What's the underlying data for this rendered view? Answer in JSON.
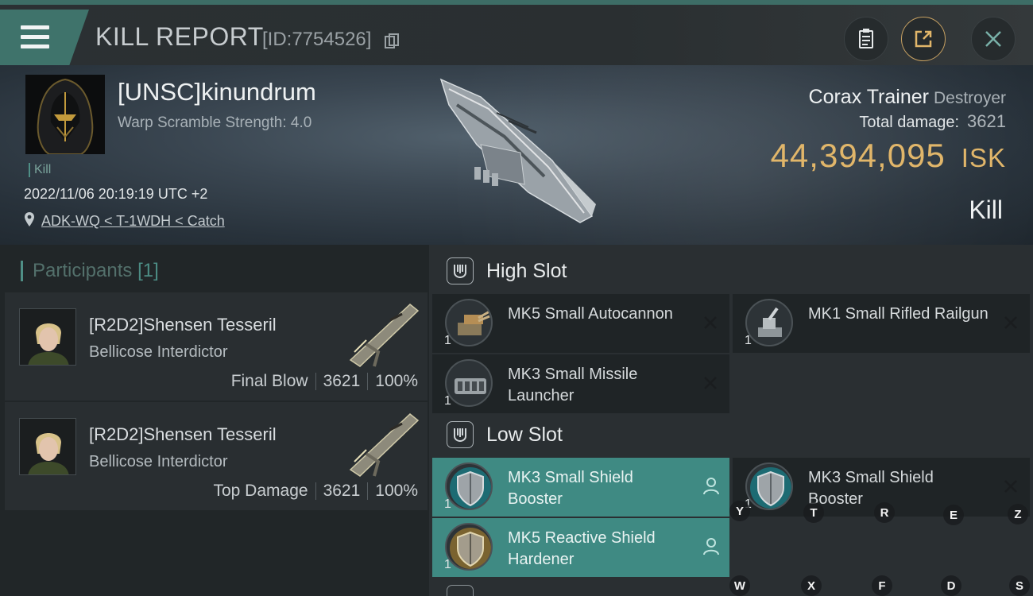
{
  "header": {
    "title": "KILL REPORT",
    "report_id": "[ID:7754526]"
  },
  "victim": {
    "name": "[UNSC]kinundrum",
    "scramble": "Warp Scramble Strength: 4.0",
    "tag": "Kill",
    "datetime": "2022/11/06 20:19:19 UTC +2",
    "location": "ADK-WQ < T-1WDH < Catch"
  },
  "ship": {
    "name": "Corax Trainer",
    "class": "Destroyer",
    "total_damage_label": "Total damage:",
    "total_damage": "3621",
    "isk_value": "44,394,095",
    "isk_unit": "ISK",
    "result": "Kill"
  },
  "participants": {
    "label": "Participants",
    "count": "[1]",
    "rows": [
      {
        "name": "[R2D2]Shensen Tesseril",
        "ship": "Bellicose Interdictor",
        "role": "Final Blow",
        "damage": "3621",
        "percent": "100%"
      },
      {
        "name": "[R2D2]Shensen Tesseril",
        "ship": "Bellicose Interdictor",
        "role": "Top Damage",
        "damage": "3621",
        "percent": "100%"
      }
    ]
  },
  "slots": {
    "high_label": "High Slot",
    "low_label": "Low Slot",
    "high": [
      {
        "name": "MK5 Small Autocannon",
        "qty": "1"
      },
      {
        "name": "MK1 Small Rifled Railgun",
        "qty": "1"
      },
      {
        "name": "MK3 Small Missile Launcher",
        "qty": "1"
      }
    ],
    "low": [
      {
        "name": "MK3 Small Shield Booster",
        "qty": "1"
      },
      {
        "name": "MK3 Small Shield Booster",
        "qty": "1"
      },
      {
        "name": "MK5 Reactive Shield Hardener",
        "qty": "1"
      }
    ]
  },
  "key_hints": [
    "Y",
    "T",
    "R",
    "E",
    "Z",
    "W",
    "X",
    "F",
    "D",
    "S"
  ],
  "colors": {
    "accent": "#3f8a83",
    "isk_gold": "#e1b66a",
    "panel": "#2a2f32"
  }
}
